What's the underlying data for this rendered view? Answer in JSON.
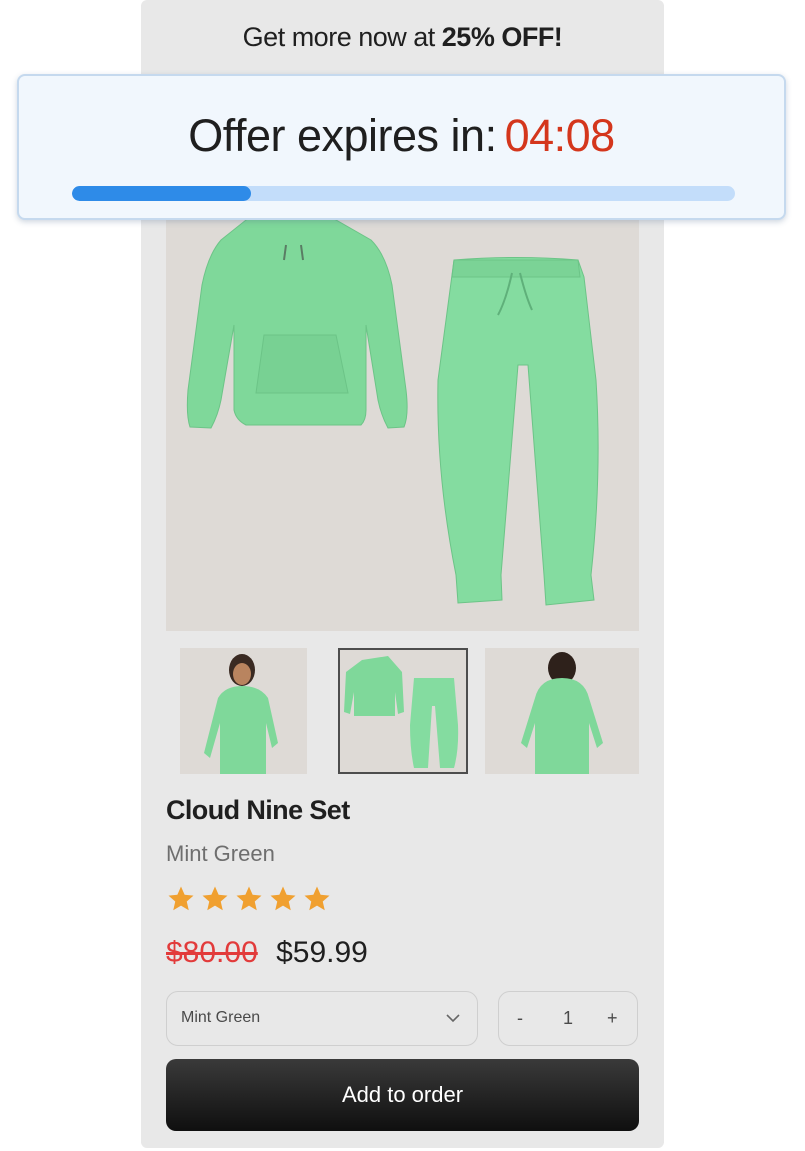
{
  "promo": {
    "text": "Get more now at",
    "highlight": "25% OFF!"
  },
  "timer": {
    "label": "Offer expires in:",
    "time": "04:08",
    "progress": 0.27
  },
  "product": {
    "name": "Cloud Nine Set",
    "color_name": "Mint Green",
    "rating": 5,
    "original_price": "$80.00",
    "sale_price": "$59.99"
  },
  "controls": {
    "color_select": "Mint Green",
    "stepper": {
      "minus": "-",
      "quantity": "1",
      "plus": "+"
    },
    "add_button": "Add to order"
  },
  "colors": {
    "accent_blue": "#2e8be8",
    "timer_red": "#d4361c",
    "strike_red": "#e23b3b",
    "star_orange": "#f0a030",
    "garment_mint": "#7fd89a"
  }
}
